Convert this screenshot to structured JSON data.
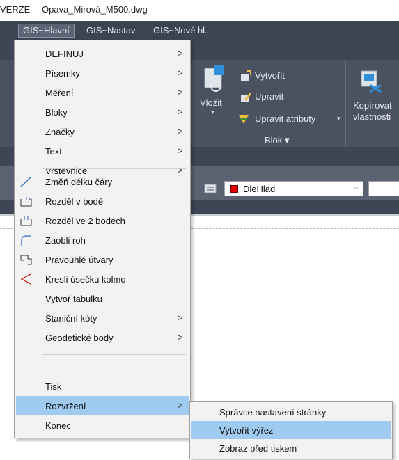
{
  "window": {
    "title_prefix": "VERZE",
    "file_name": "Opava_Mirová_M500.dwg"
  },
  "menubar": {
    "items": [
      {
        "label": "GIS~Hlavní",
        "active": true
      },
      {
        "label": "GIS~Nastav",
        "active": false
      },
      {
        "label": "GIS~Nové hl.",
        "active": false
      }
    ]
  },
  "ribbon": {
    "insert_label": "Vložit",
    "block_actions": [
      "Vytvořit",
      "Upravit",
      "Upravit atributy"
    ],
    "block_panel_label": "Blok ▾",
    "copy_props_label_1": "Kopírovat",
    "copy_props_label_2": "vlastnosti"
  },
  "properties": {
    "layer_value": "DleHlad",
    "layer_color": "#e00000"
  },
  "menu": {
    "items": [
      {
        "label": "DEFINUJ",
        "submenu": true,
        "icon": ""
      },
      {
        "label": "Písemky",
        "submenu": true,
        "icon": ""
      },
      {
        "label": "Měření",
        "submenu": true,
        "icon": ""
      },
      {
        "label": "Bloky",
        "submenu": true,
        "icon": ""
      },
      {
        "label": "Značky",
        "submenu": true,
        "icon": ""
      },
      {
        "label": "Text",
        "submenu": true,
        "icon": ""
      },
      {
        "label": "Vrstevnice",
        "submenu": true,
        "icon": ""
      },
      {
        "label": "Změň délku čáry",
        "submenu": false,
        "icon": "line-length-icon"
      },
      {
        "label": "Rozděl v bodě",
        "submenu": false,
        "icon": "split-point-icon"
      },
      {
        "label": "Rozděl ve 2 bodech",
        "submenu": false,
        "icon": "split-two-points-icon"
      },
      {
        "label": "Zaobli roh",
        "submenu": false,
        "icon": "fillet-icon"
      },
      {
        "label": "Pravoúhlé útvary",
        "submenu": false,
        "icon": "orthogonal-shapes-icon"
      },
      {
        "label": "Kresli úsečku kolmo",
        "submenu": false,
        "icon": "perpendicular-line-icon"
      },
      {
        "label": "Vytvoř tabulku",
        "submenu": false,
        "icon": ""
      },
      {
        "label": "Staniční kóty",
        "submenu": true,
        "icon": ""
      },
      {
        "label": "Geodetické body",
        "submenu": true,
        "icon": ""
      },
      {
        "label": "Tisk",
        "submenu": false,
        "icon": ""
      },
      {
        "label": "Rozvržení",
        "submenu": true,
        "icon": "",
        "highlighted": true
      },
      {
        "label": "Konec",
        "submenu": false,
        "icon": ""
      }
    ],
    "submenu_arrow": ">"
  },
  "submenu": {
    "items": [
      {
        "label": "Správce nastavení stránky",
        "highlighted": false
      },
      {
        "label": "Vytvořit výřez",
        "highlighted": true
      },
      {
        "label": "Zobraz před tiskem",
        "highlighted": false
      }
    ]
  },
  "colors": {
    "menubar_bg": "#3b4453",
    "ribbon_bg": "#4a5161",
    "highlight": "#9fcbf0"
  }
}
